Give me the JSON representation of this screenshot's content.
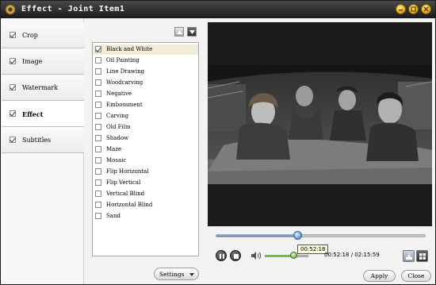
{
  "window": {
    "title": "Effect - Joint Item1"
  },
  "sidebar": {
    "items": [
      {
        "label": "Crop",
        "checked": true,
        "active": false
      },
      {
        "label": "Image",
        "checked": true,
        "active": false
      },
      {
        "label": "Watermark",
        "checked": true,
        "active": false
      },
      {
        "label": "Effect",
        "checked": true,
        "active": true
      },
      {
        "label": "Subtitles",
        "checked": true,
        "active": false
      }
    ]
  },
  "effects": {
    "items": [
      {
        "label": "Black and White",
        "checked": true
      },
      {
        "label": "Oil Painting",
        "checked": false
      },
      {
        "label": "Line Drawing",
        "checked": false
      },
      {
        "label": "Woodcarving",
        "checked": false
      },
      {
        "label": "Negative",
        "checked": false
      },
      {
        "label": "Embossment",
        "checked": false
      },
      {
        "label": "Carving",
        "checked": false
      },
      {
        "label": "Old Film",
        "checked": false
      },
      {
        "label": "Shadow",
        "checked": false
      },
      {
        "label": "Maze",
        "checked": false
      },
      {
        "label": "Mosaic",
        "checked": false
      },
      {
        "label": "Flip Horizontal",
        "checked": false
      },
      {
        "label": "Flip Vertical",
        "checked": false
      },
      {
        "label": "Vertical Blind",
        "checked": false
      },
      {
        "label": "Horizontal Blind",
        "checked": false
      },
      {
        "label": "Sand",
        "checked": false
      }
    ],
    "selected_index": 0
  },
  "buttons": {
    "settings": "Settings",
    "apply": "Apply",
    "close": "Close"
  },
  "player": {
    "progress_fraction": 0.39,
    "volume_fraction": 0.7,
    "tooltip": "00:52:18",
    "current_time": "00:52:18",
    "separator": "/",
    "total_time": "02:15:59"
  },
  "colors": {
    "titlebar": "#2a2a2a",
    "accent_blue": "#3f7fc8",
    "volume_green": "#6abf3a",
    "winbtn_gold": "#e0a60a"
  }
}
